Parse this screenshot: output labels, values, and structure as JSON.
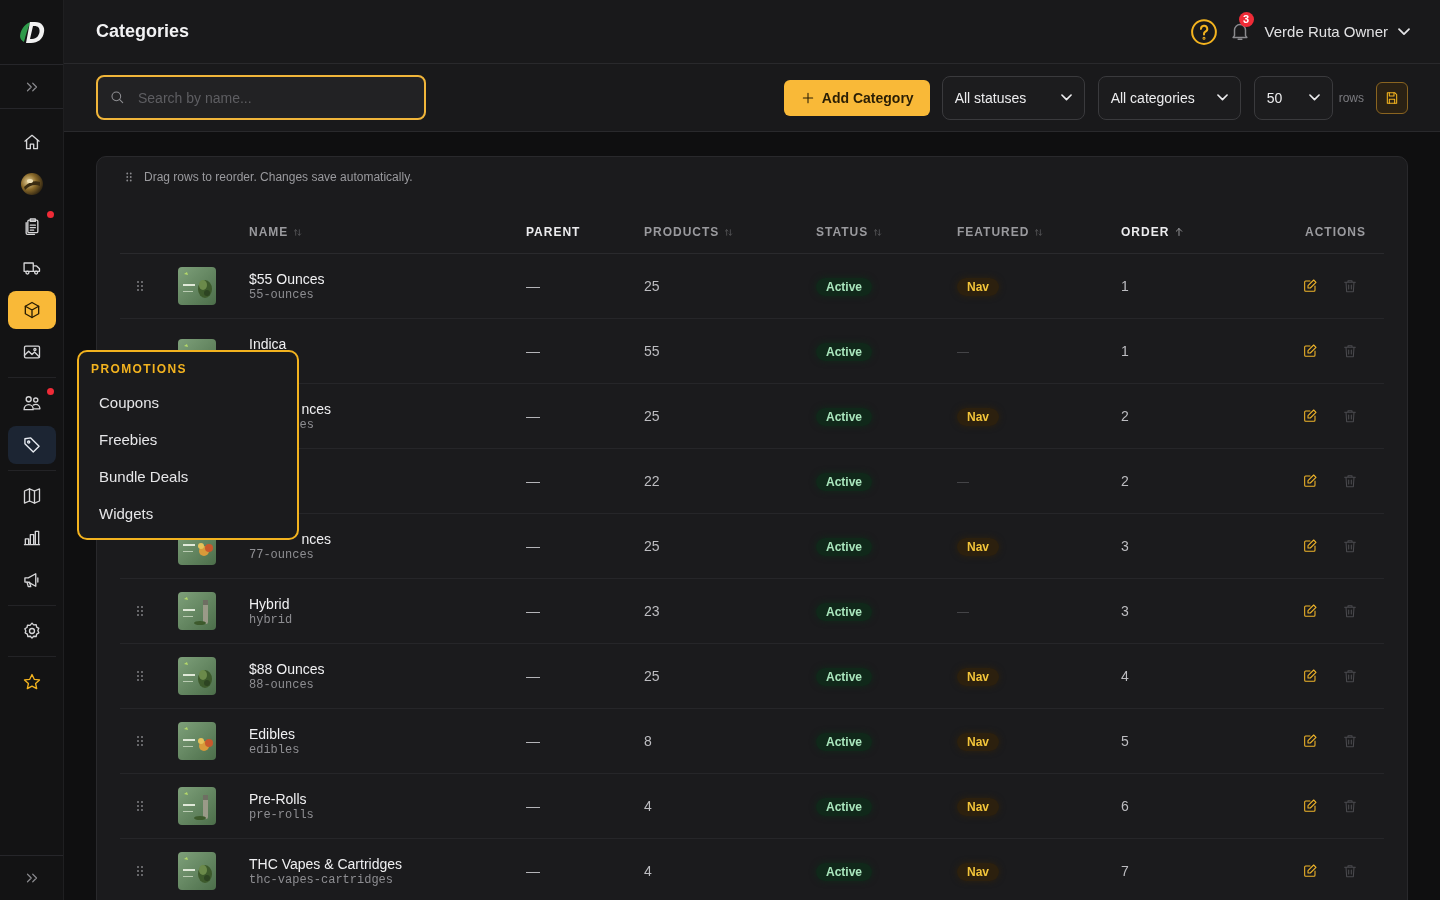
{
  "sidebar": {
    "groups": [
      {
        "items": [
          {
            "selected": false,
            "open": false,
            "alert": false
          },
          {
            "selected": false,
            "open": false,
            "alert": false
          },
          {
            "selected": false,
            "open": false,
            "alert": true
          },
          {
            "selected": false,
            "open": false,
            "alert": false
          },
          {
            "selected": true,
            "open": false,
            "alert": false
          },
          {
            "selected": false,
            "open": false,
            "alert": false
          }
        ]
      },
      {
        "items": [
          {
            "selected": false,
            "open": false,
            "alert": true
          },
          {
            "selected": false,
            "open": true,
            "alert": false
          }
        ]
      },
      {
        "items": [
          {
            "selected": false,
            "open": false,
            "alert": false
          },
          {
            "selected": false,
            "open": false,
            "alert": false
          },
          {
            "selected": false,
            "open": false,
            "alert": false
          }
        ]
      },
      {
        "items": [
          {
            "selected": false,
            "open": false,
            "alert": false
          }
        ]
      },
      {
        "items": [
          {
            "selected": false,
            "open": false,
            "alert": false
          }
        ]
      }
    ]
  },
  "header": {
    "title": "Categories",
    "notifications": "3",
    "user": "Verde Ruta Owner"
  },
  "toolbar": {
    "search": {
      "placeholder": "Search by name..."
    },
    "add_button": "Add Category",
    "filters": [
      "All statuses",
      "All categories"
    ],
    "page_size": "50",
    "page_size_unit": "rows"
  },
  "table": {
    "hint": "Drag rows to reorder. Changes save automatically.",
    "columns": [
      {
        "label": "NAME",
        "sortable": true,
        "sorted": false
      },
      {
        "label": "PARENT",
        "sortable": false,
        "sorted": false
      },
      {
        "label": "PRODUCTS",
        "sortable": true,
        "sorted": false
      },
      {
        "label": "STATUS",
        "sortable": true,
        "sorted": false
      },
      {
        "label": "FEATURED",
        "sortable": true,
        "sorted": false
      },
      {
        "label": "ORDER",
        "sortable": true,
        "sorted": true
      },
      {
        "label": "ACTIONS",
        "sortable": false,
        "sorted": false
      }
    ],
    "rows": [
      {
        "name": "$55 Ounces",
        "slug": "55-ounces",
        "name_cut": false,
        "slug_cut": false,
        "handle": true,
        "image": {
          "kind": "picture"
        },
        "parent": "—",
        "products": "25",
        "status": "Active",
        "featured": true,
        "featured_label": "Nav",
        "order": "1"
      },
      {
        "name": "Indica",
        "name_cut": false,
        "handle": false,
        "image": {
          "kind": "picture",
          "cut": true
        },
        "parent": "—",
        "products": "55",
        "status": "Active",
        "featured": false,
        "featured_label": "—",
        "order": "1"
      },
      {
        "name": "nces",
        "slug": "es",
        "name_cut": true,
        "slug_cut": true,
        "parent": "—",
        "products": "25",
        "status": "Active",
        "featured": true,
        "featured_label": "Nav",
        "order": "2"
      },
      {
        "parent": "—",
        "products": "22",
        "status": "Active",
        "featured": false,
        "featured_label": "—",
        "order": "2"
      },
      {
        "name": "nces",
        "slug": "77-ounces",
        "name_cut": true,
        "slug_cut": false,
        "image": {
          "kind": "picture"
        },
        "parent": "—",
        "products": "25",
        "status": "Active",
        "featured": true,
        "featured_label": "Nav",
        "order": "3"
      },
      {
        "name": "Hybrid",
        "slug": "hybrid",
        "name_cut": false,
        "slug_cut": false,
        "handle": true,
        "image": {
          "kind": "picture"
        },
        "parent": "—",
        "products": "23",
        "status": "Active",
        "featured": false,
        "featured_label": "—",
        "order": "3"
      },
      {
        "name": "$88 Ounces",
        "slug": "88-ounces",
        "name_cut": false,
        "slug_cut": false,
        "handle": true,
        "image": {
          "kind": "picture"
        },
        "parent": "—",
        "products": "25",
        "status": "Active",
        "featured": true,
        "featured_label": "Nav",
        "order": "4"
      },
      {
        "name": "Edibles",
        "slug": "edibles",
        "name_cut": false,
        "slug_cut": false,
        "handle": true,
        "image": {
          "kind": "picture"
        },
        "parent": "—",
        "products": "8",
        "status": "Active",
        "featured": true,
        "featured_label": "Nav",
        "order": "5"
      },
      {
        "name": "Pre-Rolls",
        "slug": "pre-rolls",
        "name_cut": false,
        "slug_cut": false,
        "handle": true,
        "image": {
          "kind": "picture"
        },
        "parent": "—",
        "products": "4",
        "status": "Active",
        "featured": true,
        "featured_label": "Nav",
        "order": "6"
      },
      {
        "name": "THC Vapes & Cartridges",
        "slug": "thc-vapes-cartridges",
        "name_cut": false,
        "slug_cut": false,
        "handle": true,
        "image": {
          "kind": "picture"
        },
        "parent": "—",
        "products": "4",
        "status": "Active",
        "featured": true,
        "featured_label": "Nav",
        "order": "7"
      }
    ]
  },
  "flyout": {
    "title": "PROMOTIONS",
    "items": [
      "Coupons",
      "Freebies",
      "Bundle Deals",
      "Widgets"
    ]
  }
}
